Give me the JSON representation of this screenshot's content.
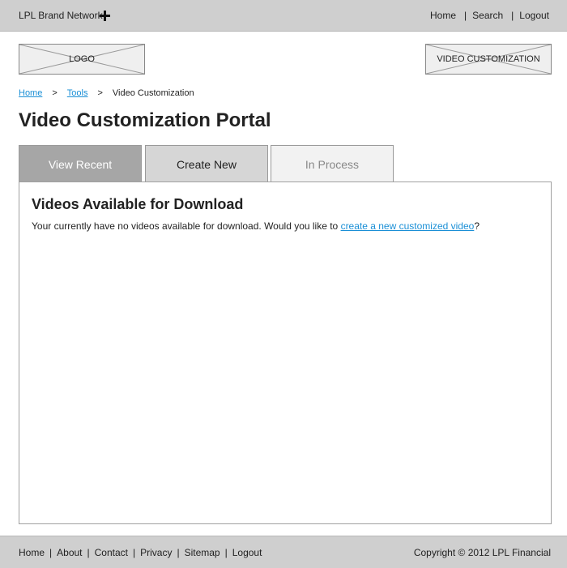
{
  "header": {
    "brand": "LPL Brand Network",
    "plus_icon": "plus-icon",
    "nav": [
      "Home",
      "Search",
      "Logout"
    ],
    "separator": "|"
  },
  "placeholders": {
    "logo_label": "LOGO",
    "video_customization_label": "VIDEO CUSTOMIZATION"
  },
  "breadcrumb": {
    "items": [
      "Home",
      "Tools",
      "Video Customization"
    ],
    "separator": ">"
  },
  "page_title": "Video Customization Portal",
  "tabs": [
    {
      "label": "View Recent",
      "state": "active"
    },
    {
      "label": "Create New",
      "state": "default"
    },
    {
      "label": "In Process",
      "state": "disabled"
    }
  ],
  "panel": {
    "title": "Videos Available for Download",
    "message_prefix": "Your currently have no videos available for download. Would you like to ",
    "message_link": "create a new customized video",
    "message_suffix": "?"
  },
  "footer": {
    "nav": [
      "Home",
      "About",
      "Contact",
      "Privacy",
      "Sitemap",
      "Logout"
    ],
    "separator": "|",
    "copyright": "Copyright © 2012 LPL Financial"
  },
  "colors": {
    "bar_gray": "#cfcfcf",
    "link_blue": "#1a8fd6",
    "tab_active": "#a6a6a6",
    "tab_default": "#d6d6d6",
    "tab_disabled": "#f2f2f2"
  }
}
